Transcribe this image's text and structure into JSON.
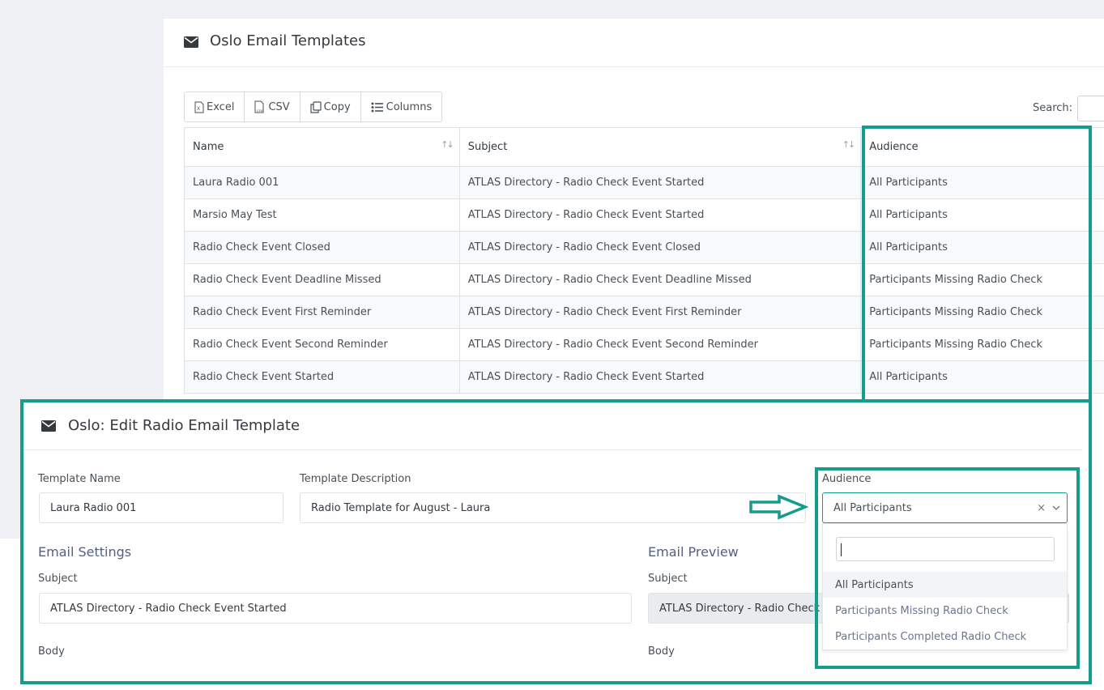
{
  "templates_card": {
    "title": "Oslo Email Templates",
    "buttons": {
      "excel": "Excel",
      "csv": "CSV",
      "copy": "Copy",
      "columns": "Columns"
    },
    "search_label": "Search:",
    "columns": [
      "Name",
      "Subject",
      "Audience"
    ],
    "rows": [
      [
        "Laura Radio 001",
        "ATLAS Directory - Radio Check Event Started",
        "All Participants"
      ],
      [
        "Marsio May Test",
        "ATLAS Directory - Radio Check Event Started",
        "All Participants"
      ],
      [
        "Radio Check Event Closed",
        "ATLAS Directory - Radio Check Event Closed",
        "All Participants"
      ],
      [
        "Radio Check Event Deadline Missed",
        "ATLAS Directory - Radio Check Event Deadline Missed",
        "Participants Missing Radio Check"
      ],
      [
        "Radio Check Event First Reminder",
        "ATLAS Directory - Radio Check Event First Reminder",
        "Participants Missing Radio Check"
      ],
      [
        "Radio Check Event Second Reminder",
        "ATLAS Directory - Radio Check Event Second Reminder",
        "Participants Missing Radio Check"
      ],
      [
        "Radio Check Event Started",
        "ATLAS Directory - Radio Check Event Started",
        "All Participants"
      ]
    ]
  },
  "edit_card": {
    "title": "Oslo: Edit Radio Email Template",
    "template_name_label": "Template Name",
    "template_name_value": "Laura Radio 001",
    "template_description_label": "Template Description",
    "template_description_value": "Radio Template for August - Laura",
    "audience_label": "Audience",
    "audience_value": "All Participants",
    "clear_symbol": "×",
    "audience_options": [
      "All Participants",
      "Participants Missing Radio Check",
      "Participants Completed Radio Check"
    ],
    "email_settings": {
      "heading": "Email Settings",
      "subject_label": "Subject",
      "subject_value": "ATLAS Directory - Radio Check Event Started",
      "body_label": "Body"
    },
    "email_preview": {
      "heading": "Email Preview",
      "subject_label": "Subject",
      "subject_value": "ATLAS Directory - Radio Check Event Started",
      "body_label": "Body"
    }
  },
  "colors": {
    "highlight": "#149c8c",
    "section_heading": "#556080"
  },
  "icons": [
    "envelope-icon",
    "excel-file-icon",
    "csv-file-icon",
    "copy-icon",
    "list-icon",
    "sort-icon",
    "chevron-down-icon",
    "clear-icon",
    "arrow-right-icon"
  ]
}
